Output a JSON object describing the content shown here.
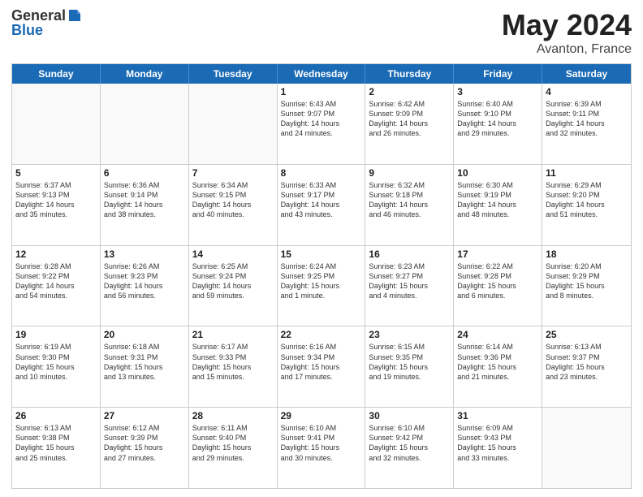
{
  "logo": {
    "general": "General",
    "blue": "Blue"
  },
  "title": {
    "month_year": "May 2024",
    "location": "Avanton, France"
  },
  "header_days": [
    "Sunday",
    "Monday",
    "Tuesday",
    "Wednesday",
    "Thursday",
    "Friday",
    "Saturday"
  ],
  "weeks": [
    [
      {
        "day": "",
        "info": ""
      },
      {
        "day": "",
        "info": ""
      },
      {
        "day": "",
        "info": ""
      },
      {
        "day": "1",
        "info": "Sunrise: 6:43 AM\nSunset: 9:07 PM\nDaylight: 14 hours\nand 24 minutes."
      },
      {
        "day": "2",
        "info": "Sunrise: 6:42 AM\nSunset: 9:09 PM\nDaylight: 14 hours\nand 26 minutes."
      },
      {
        "day": "3",
        "info": "Sunrise: 6:40 AM\nSunset: 9:10 PM\nDaylight: 14 hours\nand 29 minutes."
      },
      {
        "day": "4",
        "info": "Sunrise: 6:39 AM\nSunset: 9:11 PM\nDaylight: 14 hours\nand 32 minutes."
      }
    ],
    [
      {
        "day": "5",
        "info": "Sunrise: 6:37 AM\nSunset: 9:13 PM\nDaylight: 14 hours\nand 35 minutes."
      },
      {
        "day": "6",
        "info": "Sunrise: 6:36 AM\nSunset: 9:14 PM\nDaylight: 14 hours\nand 38 minutes."
      },
      {
        "day": "7",
        "info": "Sunrise: 6:34 AM\nSunset: 9:15 PM\nDaylight: 14 hours\nand 40 minutes."
      },
      {
        "day": "8",
        "info": "Sunrise: 6:33 AM\nSunset: 9:17 PM\nDaylight: 14 hours\nand 43 minutes."
      },
      {
        "day": "9",
        "info": "Sunrise: 6:32 AM\nSunset: 9:18 PM\nDaylight: 14 hours\nand 46 minutes."
      },
      {
        "day": "10",
        "info": "Sunrise: 6:30 AM\nSunset: 9:19 PM\nDaylight: 14 hours\nand 48 minutes."
      },
      {
        "day": "11",
        "info": "Sunrise: 6:29 AM\nSunset: 9:20 PM\nDaylight: 14 hours\nand 51 minutes."
      }
    ],
    [
      {
        "day": "12",
        "info": "Sunrise: 6:28 AM\nSunset: 9:22 PM\nDaylight: 14 hours\nand 54 minutes."
      },
      {
        "day": "13",
        "info": "Sunrise: 6:26 AM\nSunset: 9:23 PM\nDaylight: 14 hours\nand 56 minutes."
      },
      {
        "day": "14",
        "info": "Sunrise: 6:25 AM\nSunset: 9:24 PM\nDaylight: 14 hours\nand 59 minutes."
      },
      {
        "day": "15",
        "info": "Sunrise: 6:24 AM\nSunset: 9:25 PM\nDaylight: 15 hours\nand 1 minute."
      },
      {
        "day": "16",
        "info": "Sunrise: 6:23 AM\nSunset: 9:27 PM\nDaylight: 15 hours\nand 4 minutes."
      },
      {
        "day": "17",
        "info": "Sunrise: 6:22 AM\nSunset: 9:28 PM\nDaylight: 15 hours\nand 6 minutes."
      },
      {
        "day": "18",
        "info": "Sunrise: 6:20 AM\nSunset: 9:29 PM\nDaylight: 15 hours\nand 8 minutes."
      }
    ],
    [
      {
        "day": "19",
        "info": "Sunrise: 6:19 AM\nSunset: 9:30 PM\nDaylight: 15 hours\nand 10 minutes."
      },
      {
        "day": "20",
        "info": "Sunrise: 6:18 AM\nSunset: 9:31 PM\nDaylight: 15 hours\nand 13 minutes."
      },
      {
        "day": "21",
        "info": "Sunrise: 6:17 AM\nSunset: 9:33 PM\nDaylight: 15 hours\nand 15 minutes."
      },
      {
        "day": "22",
        "info": "Sunrise: 6:16 AM\nSunset: 9:34 PM\nDaylight: 15 hours\nand 17 minutes."
      },
      {
        "day": "23",
        "info": "Sunrise: 6:15 AM\nSunset: 9:35 PM\nDaylight: 15 hours\nand 19 minutes."
      },
      {
        "day": "24",
        "info": "Sunrise: 6:14 AM\nSunset: 9:36 PM\nDaylight: 15 hours\nand 21 minutes."
      },
      {
        "day": "25",
        "info": "Sunrise: 6:13 AM\nSunset: 9:37 PM\nDaylight: 15 hours\nand 23 minutes."
      }
    ],
    [
      {
        "day": "26",
        "info": "Sunrise: 6:13 AM\nSunset: 9:38 PM\nDaylight: 15 hours\nand 25 minutes."
      },
      {
        "day": "27",
        "info": "Sunrise: 6:12 AM\nSunset: 9:39 PM\nDaylight: 15 hours\nand 27 minutes."
      },
      {
        "day": "28",
        "info": "Sunrise: 6:11 AM\nSunset: 9:40 PM\nDaylight: 15 hours\nand 29 minutes."
      },
      {
        "day": "29",
        "info": "Sunrise: 6:10 AM\nSunset: 9:41 PM\nDaylight: 15 hours\nand 30 minutes."
      },
      {
        "day": "30",
        "info": "Sunrise: 6:10 AM\nSunset: 9:42 PM\nDaylight: 15 hours\nand 32 minutes."
      },
      {
        "day": "31",
        "info": "Sunrise: 6:09 AM\nSunset: 9:43 PM\nDaylight: 15 hours\nand 33 minutes."
      },
      {
        "day": "",
        "info": ""
      }
    ]
  ]
}
